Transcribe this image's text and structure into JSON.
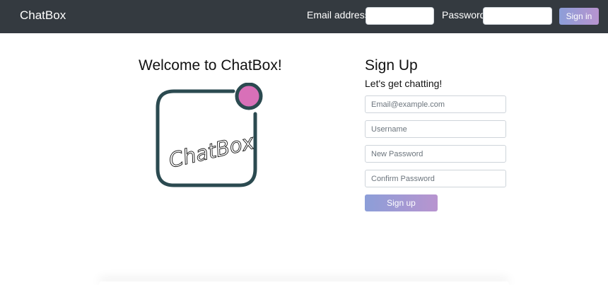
{
  "navbar": {
    "brand": "ChatBox",
    "email_label": "Email address",
    "email_value": "",
    "password_label": "Password",
    "password_value": "",
    "signin_label": "Sign in"
  },
  "welcome": {
    "title": "Welcome to ChatBox!",
    "logo_text": "ChatBox"
  },
  "signup": {
    "title": "Sign Up",
    "subtitle": "Let's get chatting!",
    "email_placeholder": "Email@example.com",
    "username_placeholder": "Username",
    "new_password_placeholder": "New Password",
    "confirm_password_placeholder": "Confirm Password",
    "button_label": "Sign up"
  },
  "colors": {
    "navbar_bg": "#343a40",
    "button_gradient_start": "#8c9ed8",
    "button_gradient_end": "#b894cf",
    "logo_frame": "#2b4a50",
    "logo_dot": "#d870b8"
  }
}
